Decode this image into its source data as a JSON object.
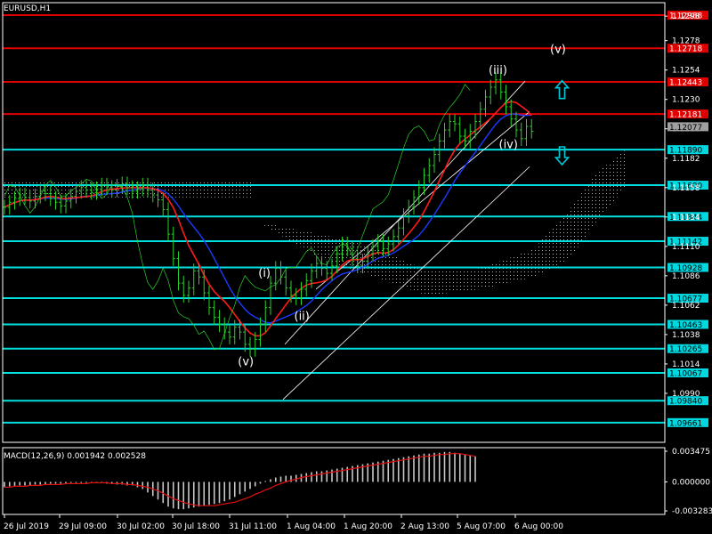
{
  "window": {
    "symbol_label": "EURUSD,H1"
  },
  "colors": {
    "background": "#000000",
    "frame": "#ffffff",
    "price": "#2bd12b",
    "red_level": "#e00000",
    "cyan_level": "#00e0e0",
    "ma_red": "#ff1a1a",
    "ma_blue": "#1a3aff",
    "cloud": "#d9a882",
    "arrow": "#00c8d8",
    "macd_hist": "#c8c8c8",
    "macd_signal": "#e01010",
    "text": "#ffffff"
  },
  "chart_data": [
    {
      "type": "candlestick",
      "title": "EURUSD,H1",
      "ylim": [
        1.095,
        1.1309
      ],
      "x_ticks": [
        "26 Jul 2019",
        "29 Jul 09:00",
        "30 Jul 02:00",
        "30 Jul 18:00",
        "31 Jul 11:00",
        "1 Aug 04:00",
        "1 Aug 20:00",
        "2 Aug 13:00",
        "5 Aug 07:00",
        "6 Aug 00:00"
      ],
      "y_ticks": [
        1.1298,
        1.1278,
        1.1254,
        1.123,
        1.1206,
        1.1182,
        1.1158,
        1.1134,
        1.111,
        1.1086,
        1.1062,
        1.1038,
        1.1014,
        1.099
      ],
      "levels": [
        {
          "label": "1.12988",
          "value": 1.12988,
          "color": "red"
        },
        {
          "label": "1.12718",
          "value": 1.12718,
          "color": "red"
        },
        {
          "label": "1.12443",
          "value": 1.12443,
          "color": "red"
        },
        {
          "label": "1.12181",
          "value": 1.12181,
          "color": "red"
        },
        {
          "label": "1.11890",
          "value": 1.1189,
          "color": "cyan"
        },
        {
          "label": "1.11600",
          "value": 1.116,
          "color": "cyan"
        },
        {
          "label": "1.11344",
          "value": 1.11344,
          "color": "cyan"
        },
        {
          "label": "1.11142",
          "value": 1.11142,
          "color": "cyan"
        },
        {
          "label": "1.10928",
          "value": 1.10928,
          "color": "cyan"
        },
        {
          "label": "1.10677",
          "value": 1.10677,
          "color": "cyan"
        },
        {
          "label": "1.10463",
          "value": 1.10463,
          "color": "cyan"
        },
        {
          "label": "1.10265",
          "value": 1.10265,
          "color": "cyan"
        },
        {
          "label": "1.10067",
          "value": 1.10067,
          "color": "cyan"
        },
        {
          "label": "1.09840",
          "value": 1.0984,
          "color": "cyan"
        },
        {
          "label": "1.09661",
          "value": 1.09661,
          "color": "cyan"
        }
      ],
      "current_price": {
        "label": "1.12077",
        "value": 1.12077
      },
      "price_series": [
        1.1142,
        1.1146,
        1.1149,
        1.1152,
        1.115,
        1.1147,
        1.1151,
        1.1155,
        1.1153,
        1.1149,
        1.1146,
        1.1143,
        1.1147,
        1.1151,
        1.1155,
        1.1158,
        1.1156,
        1.1154,
        1.1157,
        1.116,
        1.1158,
        1.1156,
        1.1159,
        1.1161,
        1.1158,
        1.1155,
        1.1157,
        1.116,
        1.1156,
        1.1152,
        1.1148,
        1.114,
        1.112,
        1.11,
        1.108,
        1.107,
        1.1076,
        1.109,
        1.1085,
        1.1072,
        1.106,
        1.1052,
        1.1046,
        1.104,
        1.1036,
        1.1044,
        1.104,
        1.103,
        1.1026,
        1.1034,
        1.1046,
        1.106,
        1.108,
        1.1092,
        1.1085,
        1.1076,
        1.107,
        1.1068,
        1.1075,
        1.1082,
        1.109,
        1.1096,
        1.1092,
        1.1088,
        1.1094,
        1.1104,
        1.1112,
        1.1108,
        1.11,
        1.1094,
        1.1098,
        1.1104,
        1.111,
        1.1114,
        1.1108,
        1.1112,
        1.1118,
        1.1125,
        1.1135,
        1.1142,
        1.115,
        1.1158,
        1.1168,
        1.1176,
        1.1185,
        1.1196,
        1.1205,
        1.1212,
        1.121,
        1.12,
        1.1196,
        1.1204,
        1.1212,
        1.1222,
        1.1232,
        1.124,
        1.1246,
        1.1236,
        1.1224,
        1.1214,
        1.1205,
        1.1198,
        1.1208,
        1.1204
      ],
      "wave_labels": [
        "(i)",
        "(ii)",
        "(iii)",
        "(iv)",
        "(v)",
        "(v)"
      ],
      "wave_points": [
        {
          "label": "(i)",
          "x_index": 51,
          "y": 1.1085
        },
        {
          "label": "(ii)",
          "x_index": 58,
          "y": 1.105
        },
        {
          "label": "(iii)",
          "x_index": 96,
          "y": 1.1251
        },
        {
          "label": "(iv)",
          "x_index": 98,
          "y": 1.119
        },
        {
          "label": "(v)",
          "x_index": 47,
          "y": 1.1013
        },
        {
          "label": "(v)",
          "x_index": 108,
          "y": 1.1268
        }
      ],
      "arrows": [
        {
          "direction": "up",
          "x_index": 102,
          "y": 1.1238
        },
        {
          "direction": "down",
          "x_index": 102,
          "y": 1.1184
        }
      ]
    },
    {
      "type": "bar",
      "title": "MACD(12,26,9) 0.001942 0.002528",
      "ylim": [
        -0.003283,
        0.003475
      ],
      "y_ticks": [
        "0.003475",
        "0.000000",
        "-0.003283"
      ],
      "histogram": [
        -0.0006,
        -0.0005,
        -0.0005,
        -0.0004,
        -0.0004,
        -0.0004,
        -0.0003,
        -0.0003,
        -0.0003,
        -0.0002,
        -0.0002,
        -0.0002,
        -0.0002,
        -0.0001,
        -0.0001,
        -0.0001,
        -0.0001,
        -0.0001,
        -0.0001,
        -0.0001,
        -0.0002,
        -0.0002,
        -0.0003,
        -0.0003,
        -0.0004,
        -0.0004,
        -0.0006,
        -0.0008,
        -0.0012,
        -0.0016,
        -0.002,
        -0.0024,
        -0.0028,
        -0.003,
        -0.0031,
        -0.0031,
        -0.003,
        -0.0029,
        -0.0028,
        -0.0027,
        -0.0026,
        -0.0025,
        -0.0024,
        -0.0022,
        -0.002,
        -0.0017,
        -0.0014,
        -0.0011,
        -0.0008,
        -0.0005,
        -0.0002,
        0.0001,
        0.0003,
        0.0005,
        0.0006,
        0.0007,
        0.0007,
        0.0008,
        0.0009,
        0.001,
        0.0011,
        0.0012,
        0.0012,
        0.0013,
        0.0014,
        0.0015,
        0.0016,
        0.0017,
        0.0018,
        0.0019,
        0.002,
        0.0021,
        0.0022,
        0.0023,
        0.0024,
        0.0025,
        0.0026,
        0.0027,
        0.0028,
        0.0029,
        0.003,
        0.0031,
        0.0032,
        0.0032,
        0.0033,
        0.0033,
        0.0034,
        0.0034,
        0.0033,
        0.0032,
        0.0031,
        0.003,
        0.0029
      ],
      "signal": [
        -0.0006,
        -0.0006,
        -0.0005,
        -0.0005,
        -0.0005,
        -0.0004,
        -0.0004,
        -0.0004,
        -0.0003,
        -0.0003,
        -0.0003,
        -0.0003,
        -0.0002,
        -0.0002,
        -0.0002,
        -0.0002,
        -0.0002,
        -0.0001,
        -0.0001,
        -0.0001,
        -0.0001,
        -0.0002,
        -0.0002,
        -0.0002,
        -0.0003,
        -0.0003,
        -0.0004,
        -0.0005,
        -0.0006,
        -0.0008,
        -0.001,
        -0.0013,
        -0.0016,
        -0.0019,
        -0.0021,
        -0.0023,
        -0.0025,
        -0.0026,
        -0.0027,
        -0.0027,
        -0.0027,
        -0.0027,
        -0.0026,
        -0.0025,
        -0.0024,
        -0.0023,
        -0.0021,
        -0.0019,
        -0.0017,
        -0.0014,
        -0.0012,
        -0.0009,
        -0.0007,
        -0.0004,
        -0.0002,
        0.0,
        0.0002,
        0.0003,
        0.0005,
        0.0006,
        0.0007,
        0.0008,
        0.0009,
        0.001,
        0.0011,
        0.0012,
        0.0013,
        0.0014,
        0.0015,
        0.0016,
        0.0017,
        0.0018,
        0.0019,
        0.002,
        0.0021,
        0.0022,
        0.0023,
        0.0024,
        0.0025,
        0.0026,
        0.0027,
        0.0028,
        0.0029,
        0.0029,
        0.003,
        0.0031,
        0.0031,
        0.0032,
        0.0032,
        0.0032,
        0.0031,
        0.003,
        0.0029
      ]
    }
  ]
}
